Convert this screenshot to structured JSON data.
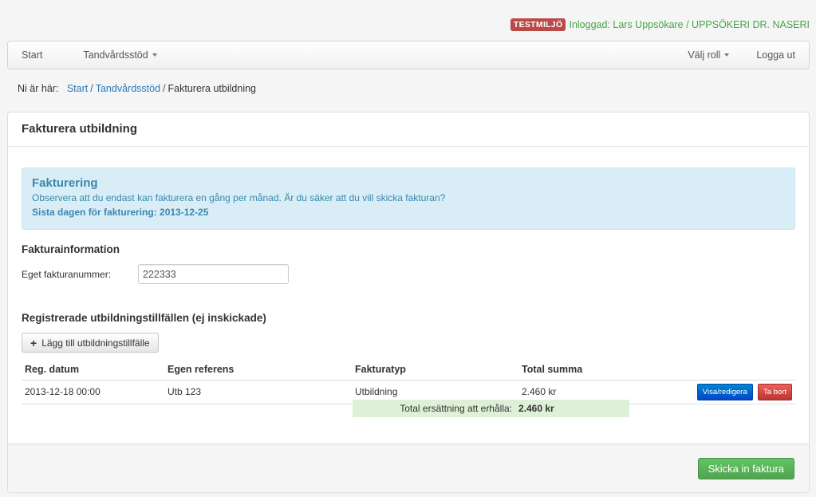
{
  "header": {
    "env_badge": "TESTMILJÖ",
    "user_info": "Inloggad: Lars Uppsökare / UPPSÖKERI DR. NASERI"
  },
  "navbar": {
    "start": "Start",
    "tandvardsstod": "Tandvårdsstöd",
    "valj_roll": "Välj roll",
    "logga_ut": "Logga ut"
  },
  "breadcrumb": {
    "prefix": "Ni är här:",
    "items": [
      "Start",
      "Tandvårdsstöd",
      "Fakturera utbildning"
    ]
  },
  "panel": {
    "title": "Fakturera utbildning"
  },
  "alert": {
    "heading": "Fakturering",
    "message": "Observera att du endast kan fakturera en gång per månad. Är du säker att du vill skicka fakturan?",
    "deadline": "Sista dagen för fakturering: 2013-12-25"
  },
  "invoice_info": {
    "title": "Fakturainformation",
    "label": "Eget fakturanummer:",
    "value": "222333"
  },
  "sessions": {
    "title": "Registrerade utbildningstillfällen (ej inskickade)",
    "add_button": "Lägg till utbildningstillfälle",
    "columns": [
      "Reg. datum",
      "Egen referens",
      "Fakturatyp",
      "Total summa"
    ],
    "rows": [
      {
        "date": "2013-12-18 00:00",
        "ref": "Utb 123",
        "type": "Utbildning",
        "sum": "2.460 kr",
        "edit_label": "Visa/redigera",
        "delete_label": "Ta bort"
      }
    ],
    "total_label": "Total ersättning att erhålla:",
    "total_value": "2.460 kr"
  },
  "footer": {
    "submit_label": "Skicka in faktura"
  },
  "colors": {
    "env_badge": "#b94a48",
    "user_info": "#46a546",
    "alert_bg": "#d9edf7",
    "alert_text": "#3a87ad",
    "link": "#2a7ab8",
    "submit": "#5bb75b",
    "edit_button": "#0055cc",
    "delete_button": "#da4f49",
    "total_bg": "#dff0d8"
  },
  "icons": {
    "add": "plus-icon",
    "dropdown": "caret-down-icon"
  }
}
